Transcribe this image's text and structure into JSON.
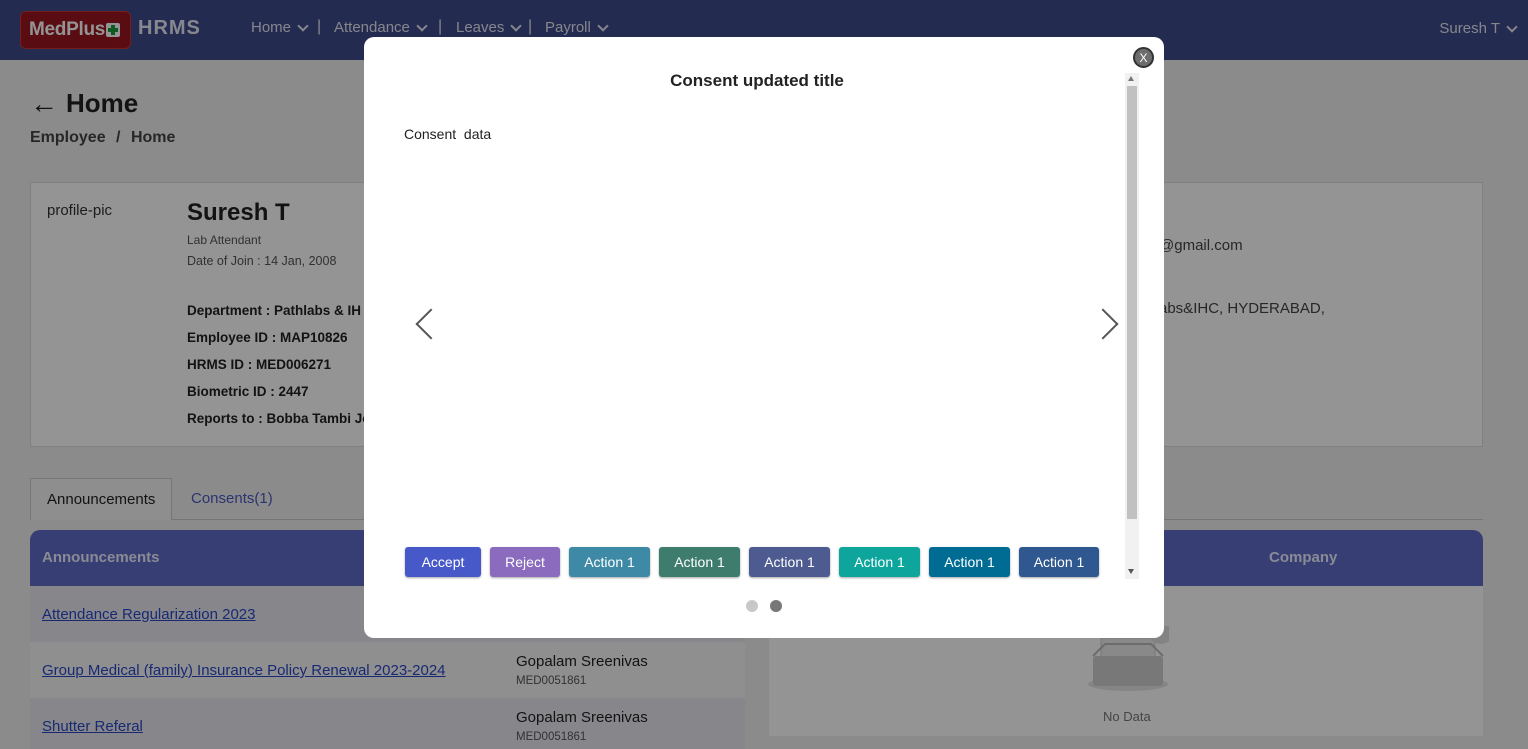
{
  "navbar": {
    "logo_text": "MedPlus",
    "brand": "HRMS",
    "menu": [
      {
        "label": "Home"
      },
      {
        "label": "Attendance"
      },
      {
        "label": "Leaves"
      },
      {
        "label": "Payroll"
      }
    ],
    "separator": "|",
    "user_name": "Suresh T"
  },
  "page": {
    "title": "Home",
    "breadcrumb": [
      "Employee",
      "/",
      "Home"
    ]
  },
  "profile": {
    "pic_alt": "profile-pic",
    "name": "Suresh T",
    "role": "Lab Attendant",
    "doj": "Date of Join : 14 Jan, 2008",
    "department": "Department : Pathlabs & IH",
    "employee_id": "Employee ID : MAP10826",
    "hrms_id": "HRMS ID : MED006271",
    "biometric_id": "Biometric ID : 2447",
    "reports_to": "Reports to : Bobba Tambi Jo",
    "email_partial": "@gmail.com",
    "address_partial": "abs&IHC, HYDERABAD,"
  },
  "tabs": [
    {
      "label": "Announcements",
      "active": true
    },
    {
      "label": "Consents(1)",
      "active": false
    }
  ],
  "announcements": {
    "header": "Announcements",
    "rows": [
      {
        "title": "Attendance Regularization 2023",
        "by": "",
        "by_id": ""
      },
      {
        "title": "Group Medical (family) Insurance Policy Renewal 2023-2024",
        "by": "Gopalam Sreenivas",
        "by_id": "MED0051861"
      },
      {
        "title": "Shutter Referal",
        "by": "Gopalam Sreenivas",
        "by_id": "MED0051861"
      }
    ]
  },
  "right_panel": {
    "company_header": "Company",
    "empty_text": "No Data"
  },
  "modal": {
    "close_label": "X",
    "title": "Consent updated title",
    "body": "Consent  data",
    "buttons": [
      {
        "label": "Accept",
        "color": "#4759c9"
      },
      {
        "label": "Reject",
        "color": "#8a6bbd"
      },
      {
        "label": "Action 1",
        "color": "#3e8aa6"
      },
      {
        "label": "Action 1",
        "color": "#3e7c6d"
      },
      {
        "label": "Action 1",
        "color": "#4d5b90"
      },
      {
        "label": "Action 1",
        "color": "#0ea69c"
      },
      {
        "label": "Action 1",
        "color": "#006c93"
      },
      {
        "label": "Action 1",
        "color": "#2f5790"
      }
    ],
    "slides": {
      "count": 2,
      "active": 2
    }
  },
  "colors": {
    "navbar": "#3f4a8c",
    "header_blue": "#5d6cc9",
    "link": "#2a48c6",
    "logo_red": "#9b1621"
  }
}
